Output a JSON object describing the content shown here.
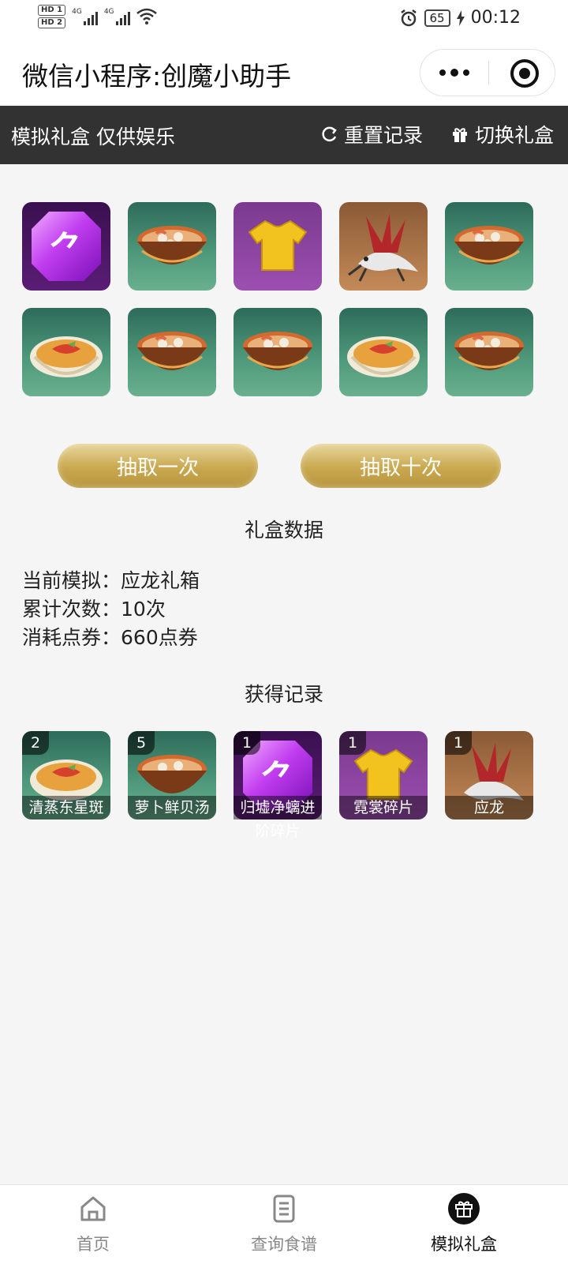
{
  "status_bar": {
    "hd1": "HD 1",
    "hd2": "HD 2",
    "net1": "4G",
    "net2": "4G",
    "battery": "65",
    "time": "00:12"
  },
  "title_bar": {
    "title": "微信小程序:创魔小助手"
  },
  "header": {
    "title": "模拟礼盒 仅供娱乐",
    "reset_label": "重置记录",
    "switch_label": "切换礼盒"
  },
  "draw_results": [
    {
      "item": "归墟净螭进阶碎片",
      "icon": "gem-icon"
    },
    {
      "item": "萝卜鲜贝汤",
      "icon": "soup-bowl-icon"
    },
    {
      "item": "霓裳碎片",
      "icon": "shirt-icon"
    },
    {
      "item": "应龙",
      "icon": "dragon-icon"
    },
    {
      "item": "萝卜鲜贝汤",
      "icon": "soup-bowl-icon"
    },
    {
      "item": "清蒸东星斑",
      "icon": "fish-dish-icon"
    },
    {
      "item": "萝卜鲜贝汤",
      "icon": "soup-bowl-icon"
    },
    {
      "item": "萝卜鲜贝汤",
      "icon": "soup-bowl-icon"
    },
    {
      "item": "清蒸东星斑",
      "icon": "fish-dish-icon"
    },
    {
      "item": "萝卜鲜贝汤",
      "icon": "soup-bowl-icon"
    }
  ],
  "buttons": {
    "draw_once": "抽取一次",
    "draw_ten": "抽取十次"
  },
  "stats": {
    "section_title": "礼盒数据",
    "current_label": "当前模拟：",
    "current_value": "应龙礼箱",
    "count_label": "累计次数：",
    "count_value": "10次",
    "cost_label": "消耗点券：",
    "cost_value": "660点券"
  },
  "records": {
    "section_title": "获得记录",
    "items": [
      {
        "count": "2",
        "name": "清蒸东星斑"
      },
      {
        "count": "5",
        "name": "萝卜鲜贝汤"
      },
      {
        "count": "1",
        "name": "归墟净螭进阶碎片"
      },
      {
        "count": "1",
        "name": "霓裳碎片"
      },
      {
        "count": "1",
        "name": "应龙"
      }
    ]
  },
  "tabbar": {
    "home": "首页",
    "recipes": "查询食谱",
    "giftbox": "模拟礼盒"
  },
  "colors": {
    "header_bg": "#323232",
    "gold_button": "#c9a84f",
    "page_bg": "#f5f5f5"
  }
}
